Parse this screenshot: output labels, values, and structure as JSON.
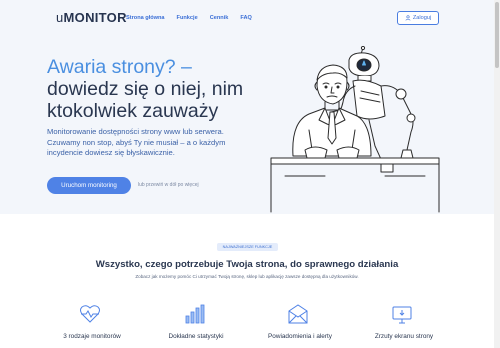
{
  "header": {
    "logo_prefix": "u",
    "logo_main": "MONITOR",
    "nav": [
      "Strona główna",
      "Funkcje",
      "Cennik",
      "FAQ"
    ],
    "login_label": "Zaloguj"
  },
  "hero": {
    "title_line1": "Awaria strony? –",
    "title_line2": "dowiedz się o niej, nim",
    "title_line3": "ktokolwiek zauważy",
    "description": "Monitorowanie dostępności strony www lub serwera. Czuwamy non stop, abyś Ty nie musiał – a o każdym incydencie dowiesz się błyskawicznie.",
    "cta_label": "Uruchom monitoring",
    "cta_note": "lub przewiń w dół po więcej"
  },
  "features": {
    "badge": "NAJWAŻNIEJSZE FUNKCJE",
    "title": "Wszystko, czego potrzebuje Twoja strona, do sprawnego działania",
    "subtitle": "Zobacz jak możemy pomóc Ci utrzymać Twoją stronę, sklep lub aplikację zawsze dostępną dla użytkowników.",
    "items": [
      {
        "label": "3 rodzaje monitorów",
        "icon": "heart-pulse-icon"
      },
      {
        "label": "Dokładne statystyki",
        "icon": "bar-chart-icon"
      },
      {
        "label": "Powiadomienia i alerty",
        "icon": "envelope-icon"
      },
      {
        "label": "Zrzuty ekranu strony",
        "icon": "monitor-icon"
      }
    ]
  },
  "colors": {
    "accent": "#4f82e6",
    "hero_background": "#f3f6fb",
    "title_blue": "#4a8fe0",
    "dark_text": "#2a3750"
  }
}
